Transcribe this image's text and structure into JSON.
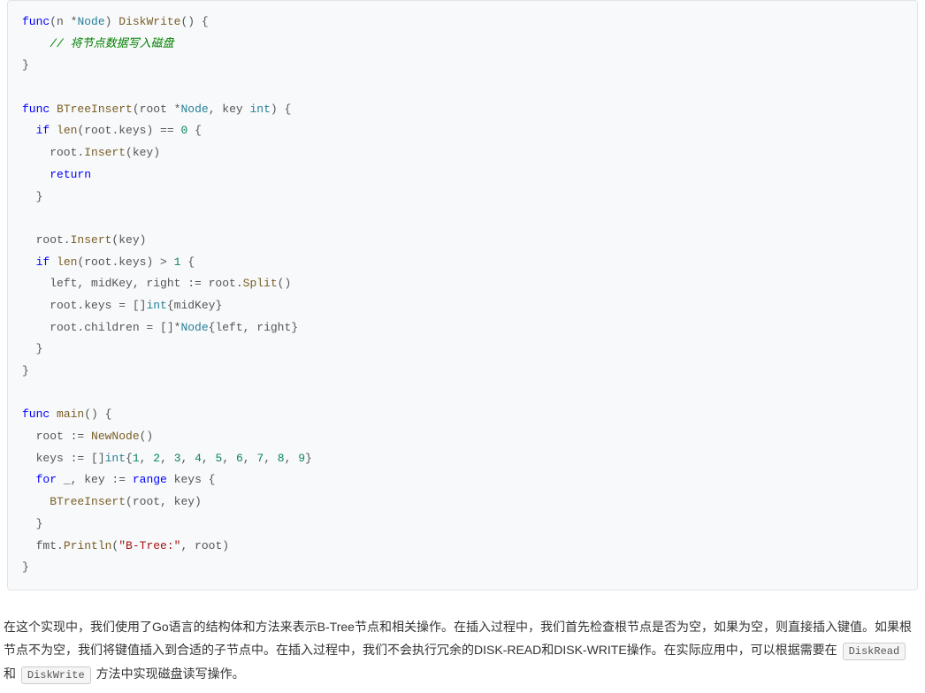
{
  "code": {
    "l1_func": "func",
    "l1_n": "(n *",
    "l1_node": "Node",
    "l1_rparen": ") ",
    "l1_method": "DiskWrite",
    "l1_sig": "() {",
    "l2_comment": "    // 将节点数据写入磁盘",
    "l3": "}",
    "l5_func": "func",
    "l5_space": " ",
    "l5_method": "BTreeInsert",
    "l5_paren": "(root *",
    "l5_node": "Node",
    "l5_keypart": ", key ",
    "l5_int": "int",
    "l5_end": ") {",
    "l6_if": "  if",
    "l6_space": " ",
    "l6_len": "len",
    "l6_mid": "(root.keys) == ",
    "l6_zero": "0",
    "l6_end": " {",
    "l7_pre": "    root.",
    "l7_insert": "Insert",
    "l7_end": "(key)",
    "l8_pre": "    ",
    "l8_return": "return",
    "l9": "  }",
    "l11_pre": "  root.",
    "l11_insert": "Insert",
    "l11_end": "(key)",
    "l12_if": "  if",
    "l12_space": " ",
    "l12_len": "len",
    "l12_mid": "(root.keys) > ",
    "l12_one": "1",
    "l12_end": " {",
    "l13_pre": "    left, midKey, right := root.",
    "l13_split": "Split",
    "l13_end": "()",
    "l14_pre": "    root.keys = []",
    "l14_int": "int",
    "l14_end": "{midKey}",
    "l15_pre": "    root.children = []*",
    "l15_node": "Node",
    "l15_end": "{left, right}",
    "l16": "  }",
    "l17": "}",
    "l19_func": "func",
    "l19_space": " ",
    "l19_main": "main",
    "l19_end": "() {",
    "l20_pre": "  root := ",
    "l20_new": "NewNode",
    "l20_end": "()",
    "l21_pre": "  keys := []",
    "l21_int": "int",
    "l21_brace": "{",
    "l21_n1": "1",
    "l21_c": ", ",
    "l21_n2": "2",
    "l21_n3": "3",
    "l21_n4": "4",
    "l21_n5": "5",
    "l21_n6": "6",
    "l21_n7": "7",
    "l21_n8": "8",
    "l21_n9": "9",
    "l21_end": "}",
    "l22_for": "  for",
    "l22_mid": " _, key := ",
    "l22_range": "range",
    "l22_end": " keys {",
    "l23_pre": "    ",
    "l23_insert": "BTreeInsert",
    "l23_end": "(root, key)",
    "l24": "  }",
    "l25_pre": "  fmt.",
    "l25_println": "Println",
    "l25_paren": "(",
    "l25_str": "\"B-Tree:\"",
    "l25_end": ", root)",
    "l26": "}"
  },
  "para": {
    "t1": "在这个实现中，我们使用了Go语言的结构体和方法来表示B-Tree节点和相关操作。在插入过程中，我们首先检查根节点是否为空，如果为空，则直接插入键值。如果根节点不为空，我们将键值插入到合适的子节点中。在插入过程中，我们不会执行冗余的DISK-READ和DISK-WRITE操作。在实际应用中，可以根据需要在 ",
    "code1": "DiskRead",
    "t2": " 和 ",
    "code2": "DiskWrite",
    "t3": " 方法中实现磁盘读写操作。"
  }
}
